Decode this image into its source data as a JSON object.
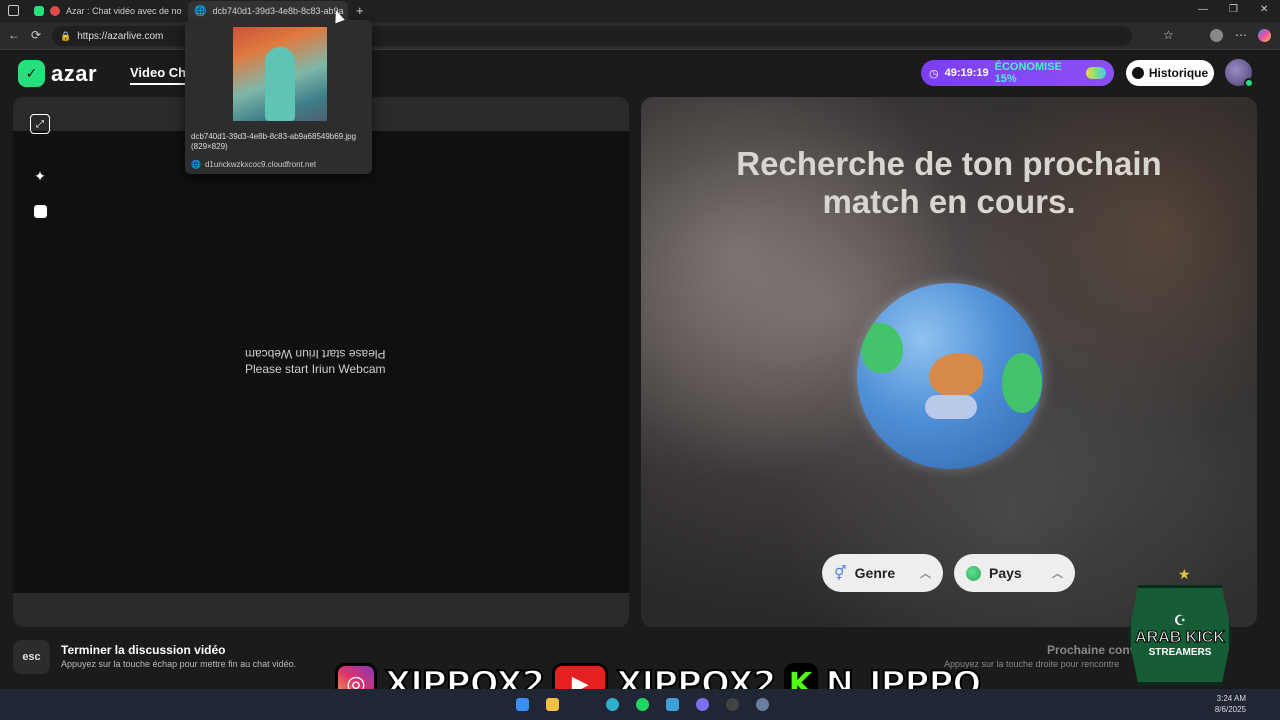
{
  "browser": {
    "tabs": [
      {
        "title": "Azar : Chat vidéo avec de no",
        "close": "✕"
      },
      {
        "title": "dcb740d1-39d3-4e8b-8c83-ab9a",
        "close": "✕"
      }
    ],
    "new_tab": "+",
    "window_controls": {
      "minimize": "—",
      "maximize": "❐",
      "close": "✕"
    },
    "url": "https://azarlive.com"
  },
  "tab_preview": {
    "filename": "dcb740d1-39d3-4e8b-8c83-ab9a68549b69.jpg",
    "dimensions": "(829×829)",
    "host": "d1unckwzkxcoc9.cloudfront.net"
  },
  "header": {
    "logo_text": "azar",
    "nav_link": "Video Ch",
    "promo_timer": "49:19:19",
    "promo_text": "ÉCONOMISE 15%",
    "history_label": "Historique"
  },
  "left_panel": {
    "webcam_message": "Please start Iriun Webcam"
  },
  "right_panel": {
    "title_line1": "Recherche de ton prochain",
    "title_line2": "match en cours.",
    "filters": [
      {
        "label": "Genre"
      },
      {
        "label": "Pays"
      }
    ]
  },
  "bottom": {
    "esc_key": "esc",
    "end_title": "Terminer la discussion vidéo",
    "end_hint": "Appuyez sur la touche échap pour mettre fin au chat vidéo.",
    "next_title": "Prochaine conv",
    "next_hint": "Appuyez sur la touche droite pour rencontre"
  },
  "overlay": {
    "handles": [
      {
        "platform": "instagram",
        "handle": "XIPPOX2"
      },
      {
        "platform": "youtube",
        "handle": "XIPPOX2"
      },
      {
        "platform": "kick",
        "handle": "N_IPPPO"
      }
    ],
    "badge_line1": "ARAB KICK",
    "badge_line2": "STREAMERS"
  },
  "taskbar": {
    "time": "3:24 AM",
    "date": "8/6/2025"
  },
  "colors": {
    "brand_green": "#26e07c",
    "promo_purple": "#8c4ff5",
    "promo_accent": "#4ef0c6"
  }
}
